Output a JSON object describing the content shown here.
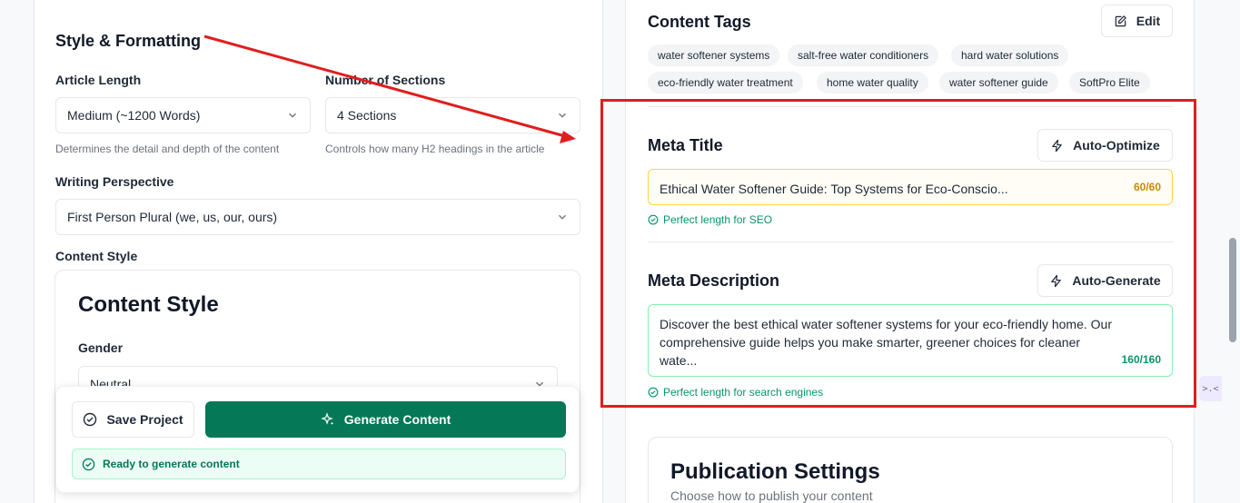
{
  "left": {
    "section_title": "Style & Formatting",
    "article_length": {
      "label": "Article Length",
      "value": "Medium (~1200 Words)",
      "hint": "Determines the detail and depth of the content"
    },
    "sections": {
      "label": "Number of Sections",
      "value": "4 Sections",
      "hint": "Controls how many H2 headings in the article"
    },
    "perspective": {
      "label": "Writing Perspective",
      "value": "First Person Plural (we, us, our, ours)"
    },
    "content_style": {
      "label": "Content Style",
      "card_title": "Content Style",
      "gender_label": "Gender",
      "gender_value": "Neutral"
    },
    "actions": {
      "save_label": "Save Project",
      "generate_label": "Generate Content",
      "status": "Ready to generate content"
    }
  },
  "right": {
    "tags": {
      "title": "Content Tags",
      "edit_label": "Edit",
      "items": [
        "water softener systems",
        "salt-free water conditioners",
        "hard water solutions",
        "eco-friendly water treatment",
        "home water quality",
        "water softener guide",
        "SoftPro Elite"
      ]
    },
    "meta_title": {
      "title": "Meta Title",
      "button_label": "Auto-Optimize",
      "value": "Ethical Water Softener Guide: Top Systems for Eco-Conscio...",
      "counter": "60/60",
      "status": "Perfect length for SEO"
    },
    "meta_description": {
      "title": "Meta Description",
      "button_label": "Auto-Generate",
      "value_line1": "Discover the best ethical water softener systems for your eco-friendly home. Our",
      "value_line2": "comprehensive guide helps you make smarter, greener choices for cleaner",
      "value_line3": "wate...",
      "counter": "160/160",
      "status": "Perfect length for search engines"
    },
    "publication": {
      "title": "Publication Settings",
      "subtitle": "Choose how to publish your content"
    }
  },
  "overlay": {
    "side_widget": ">.<"
  },
  "colors": {
    "primary": "#047857",
    "annotation": "#e11d1d",
    "warning_counter": "#ca8a04",
    "success": "#059669"
  }
}
